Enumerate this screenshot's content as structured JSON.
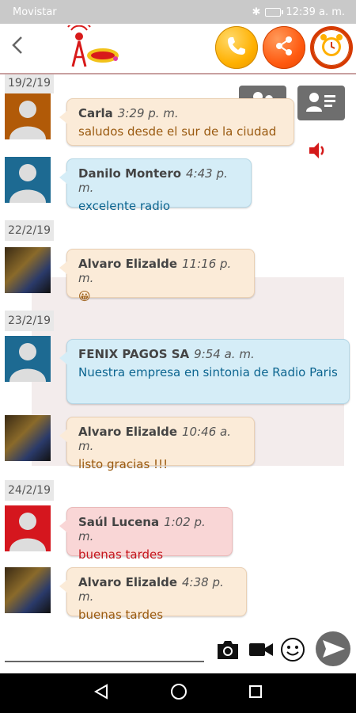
{
  "status": {
    "carrier": "Movistar",
    "time": "12:39 a. m."
  },
  "chat": {
    "items": [
      {
        "date": "19/2/19"
      },
      {
        "sender": "Carla",
        "time": "3:29 p. m.",
        "text": "saludos desde el sur de la ciudad",
        "avatar": "default-brown"
      },
      {
        "sender": "Danilo Montero",
        "time": "4:43 p. m.",
        "text": "excelente radio",
        "avatar": "default-blue"
      },
      {
        "date": "22/2/19"
      },
      {
        "sender": "Alvaro Elizalde",
        "time": "11:16 p. m.",
        "text": "😀",
        "avatar": "photo"
      },
      {
        "date": "23/2/19"
      },
      {
        "sender": "FENIX PAGOS SA",
        "time": "9:54 a. m.",
        "text": "Nuestra empresa en sintonia de Radio Paris",
        "avatar": "default-blue"
      },
      {
        "sender": "Alvaro Elizalde",
        "time": "10:46 a. m.",
        "text": "listo gracias !!!",
        "avatar": "photo"
      },
      {
        "date": "24/2/19"
      },
      {
        "sender": "Saúl Lucena",
        "time": "1:02 p. m.",
        "text": "buenas tardes",
        "avatar": "default-red"
      },
      {
        "sender": "Alvaro Elizalde",
        "time": "4:38 p. m.",
        "text": "buenas tardes",
        "avatar": "photo"
      }
    ]
  },
  "composer": {
    "placeholder": ""
  },
  "colors": {
    "accent": "#ff5a10",
    "header_line": "#c8a0a0"
  }
}
